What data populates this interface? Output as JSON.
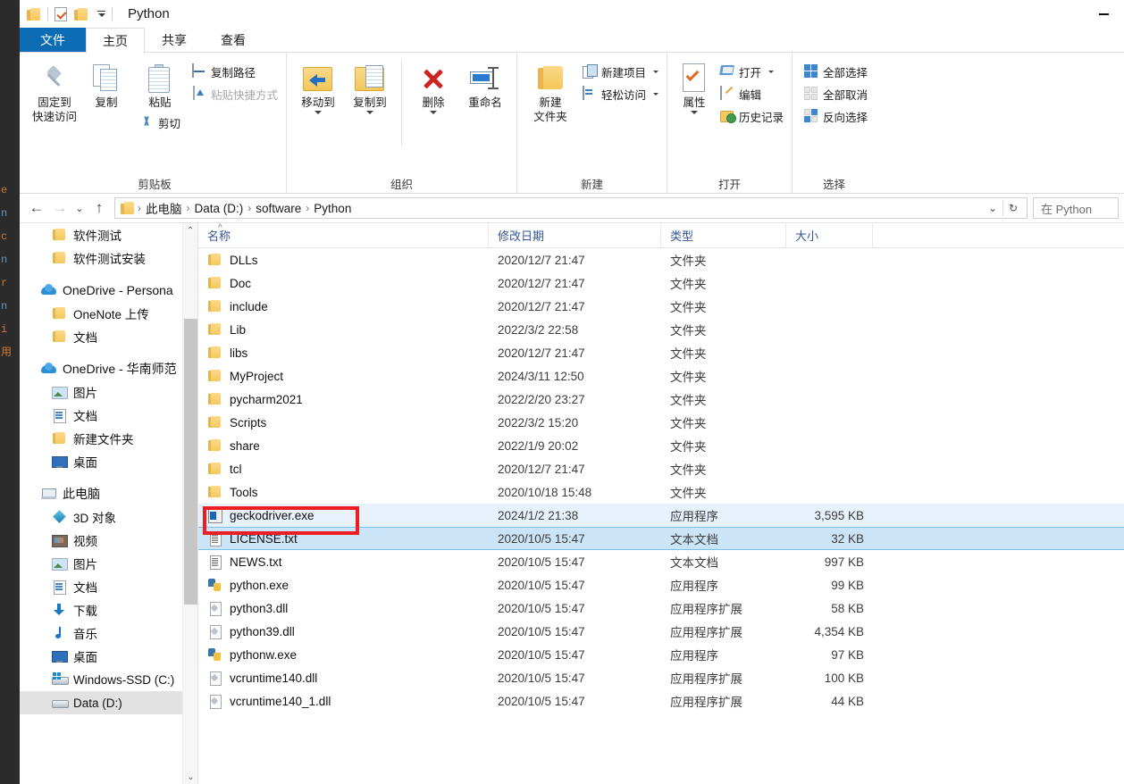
{
  "window": {
    "title": "Python",
    "minimize_label": "—",
    "quick_access": [
      "folder-icon",
      "properties-check-icon",
      "new-folder-icon",
      "customize-caret-icon"
    ]
  },
  "ribbon": {
    "tabs": [
      {
        "label": "文件",
        "state": "file"
      },
      {
        "label": "主页",
        "state": "active"
      },
      {
        "label": "共享",
        "state": "normal"
      },
      {
        "label": "查看",
        "state": "normal"
      }
    ],
    "groups": [
      {
        "name": "clipboard",
        "label": "剪贴板",
        "big_buttons": [
          {
            "label": "固定到\n快速访问",
            "line1": "固定到",
            "line2": "快速访问",
            "icon": "pin-icon"
          },
          {
            "label": "复制",
            "icon": "copy-icon"
          },
          {
            "label": "粘贴",
            "icon": "paste-icon"
          }
        ],
        "small_buttons": [
          {
            "label": "复制路径",
            "icon": "copy-path-icon"
          },
          {
            "label": "粘贴快捷方式",
            "icon": "paste-shortcut-icon",
            "dim": true
          },
          {
            "label": "剪切",
            "icon": "cut-scissors-icon"
          }
        ]
      },
      {
        "name": "organize",
        "label": "组织",
        "big_buttons": [
          {
            "label": "移动到",
            "icon": "move-to-icon",
            "has_caret": true
          },
          {
            "label": "复制到",
            "icon": "copy-to-icon",
            "has_caret": true
          },
          {
            "label": "删除",
            "icon": "delete-x-icon",
            "has_caret": true
          },
          {
            "label": "重命名",
            "icon": "rename-icon"
          }
        ]
      },
      {
        "name": "new",
        "label": "新建",
        "big_buttons": [
          {
            "line1": "新建",
            "line2": "文件夹",
            "label": "新建文件夹",
            "icon": "new-folder-icon"
          }
        ],
        "small_buttons": [
          {
            "label": "新建项目",
            "icon": "new-item-icon",
            "has_caret": true
          },
          {
            "label": "轻松访问",
            "icon": "easy-access-icon",
            "has_caret": true
          }
        ]
      },
      {
        "name": "open",
        "label": "打开",
        "big_buttons": [
          {
            "label": "属性",
            "icon": "properties-icon",
            "has_caret": true
          }
        ],
        "small_buttons": [
          {
            "label": "打开",
            "icon": "open-icon",
            "has_caret": true
          },
          {
            "label": "编辑",
            "icon": "edit-icon"
          },
          {
            "label": "历史记录",
            "icon": "history-icon"
          }
        ]
      },
      {
        "name": "select",
        "label": "选择",
        "small_buttons": [
          {
            "label": "全部选择",
            "icon": "select-all-icon"
          },
          {
            "label": "全部取消",
            "icon": "select-none-icon"
          },
          {
            "label": "反向选择",
            "icon": "invert-selection-icon"
          }
        ]
      }
    ]
  },
  "address": {
    "back_icon": "back-arrow-icon",
    "forward_icon": "forward-arrow-icon",
    "recent_icon": "recent-locations-caret-icon",
    "up_icon": "up-arrow-icon",
    "crumbs": [
      "此电脑",
      "Data (D:)",
      "software",
      "Python"
    ],
    "separator": "›",
    "dropdown_icon": "address-dropdown-icon",
    "refresh_icon": "refresh-icon",
    "search_text": "在 Python"
  },
  "nav_pane": {
    "items": [
      {
        "label": "软件测试",
        "icon": "folder-icon",
        "level": "child"
      },
      {
        "label": "软件测试安装",
        "icon": "folder-icon",
        "level": "child"
      },
      {
        "label": "",
        "icon": "",
        "level": "gap"
      },
      {
        "label": "OneDrive - Persona",
        "icon": "onedrive-cloud-icon",
        "level": "root"
      },
      {
        "label": "OneNote 上传",
        "icon": "folder-icon",
        "level": "child"
      },
      {
        "label": "文档",
        "icon": "folder-icon",
        "level": "child"
      },
      {
        "label": "",
        "icon": "",
        "level": "gap"
      },
      {
        "label": "OneDrive - 华南师范",
        "icon": "onedrive-cloud-icon",
        "level": "root"
      },
      {
        "label": "图片",
        "icon": "pictures-icon",
        "level": "child"
      },
      {
        "label": "文档",
        "icon": "documents-icon",
        "level": "child"
      },
      {
        "label": "新建文件夹",
        "icon": "folder-icon",
        "level": "child"
      },
      {
        "label": "桌面",
        "icon": "desktop-icon",
        "level": "child"
      },
      {
        "label": "",
        "icon": "",
        "level": "gap"
      },
      {
        "label": "此电脑",
        "icon": "this-pc-icon",
        "level": "root"
      },
      {
        "label": "3D 对象",
        "icon": "3d-objects-icon",
        "level": "child"
      },
      {
        "label": "视频",
        "icon": "videos-icon",
        "level": "child"
      },
      {
        "label": "图片",
        "icon": "pictures-icon",
        "level": "child"
      },
      {
        "label": "文档",
        "icon": "documents-icon",
        "level": "child"
      },
      {
        "label": "下载",
        "icon": "downloads-icon",
        "level": "child"
      },
      {
        "label": "音乐",
        "icon": "music-icon",
        "level": "child"
      },
      {
        "label": "桌面",
        "icon": "desktop-icon",
        "level": "child"
      },
      {
        "label": "Windows-SSD (C:)",
        "icon": "windows-drive-icon",
        "level": "child"
      },
      {
        "label": "Data (D:)",
        "icon": "drive-icon",
        "level": "child",
        "selected": true
      }
    ],
    "scroll_up_icon": "scroll-up-icon",
    "scroll_down_icon": "scroll-down-icon"
  },
  "file_list": {
    "columns": [
      "名称",
      "修改日期",
      "类型",
      "大小"
    ],
    "sort_column": "名称",
    "sort_indicator": "^",
    "rows": [
      {
        "name": "DLLs",
        "date": "2020/12/7 21:47",
        "type": "文件夹",
        "size": "",
        "icon": "folder-icon"
      },
      {
        "name": "Doc",
        "date": "2020/12/7 21:47",
        "type": "文件夹",
        "size": "",
        "icon": "folder-icon"
      },
      {
        "name": "include",
        "date": "2020/12/7 21:47",
        "type": "文件夹",
        "size": "",
        "icon": "folder-icon"
      },
      {
        "name": "Lib",
        "date": "2022/3/2 22:58",
        "type": "文件夹",
        "size": "",
        "icon": "folder-icon"
      },
      {
        "name": "libs",
        "date": "2020/12/7 21:47",
        "type": "文件夹",
        "size": "",
        "icon": "folder-icon"
      },
      {
        "name": "MyProject",
        "date": "2024/3/11 12:50",
        "type": "文件夹",
        "size": "",
        "icon": "folder-icon"
      },
      {
        "name": "pycharm2021",
        "date": "2022/2/20 23:27",
        "type": "文件夹",
        "size": "",
        "icon": "folder-icon"
      },
      {
        "name": "Scripts",
        "date": "2022/3/2 15:20",
        "type": "文件夹",
        "size": "",
        "icon": "folder-icon"
      },
      {
        "name": "share",
        "date": "2022/1/9 20:02",
        "type": "文件夹",
        "size": "",
        "icon": "folder-icon"
      },
      {
        "name": "tcl",
        "date": "2020/12/7 21:47",
        "type": "文件夹",
        "size": "",
        "icon": "folder-icon"
      },
      {
        "name": "Tools",
        "date": "2020/10/18 15:48",
        "type": "文件夹",
        "size": "",
        "icon": "folder-icon"
      },
      {
        "name": "geckodriver.exe",
        "date": "2024/1/2 21:38",
        "type": "应用程序",
        "size": "3,595 KB",
        "icon": "exe-icon",
        "selection": "soft",
        "annotated": true
      },
      {
        "name": "LICENSE.txt",
        "date": "2020/10/5 15:47",
        "type": "文本文档",
        "size": "32 KB",
        "icon": "text-file-icon",
        "selection": "hard"
      },
      {
        "name": "NEWS.txt",
        "date": "2020/10/5 15:47",
        "type": "文本文档",
        "size": "997 KB",
        "icon": "text-file-icon"
      },
      {
        "name": "python.exe",
        "date": "2020/10/5 15:47",
        "type": "应用程序",
        "size": "99 KB",
        "icon": "python-exe-icon"
      },
      {
        "name": "python3.dll",
        "date": "2020/10/5 15:47",
        "type": "应用程序扩展",
        "size": "58 KB",
        "icon": "dll-icon"
      },
      {
        "name": "python39.dll",
        "date": "2020/10/5 15:47",
        "type": "应用程序扩展",
        "size": "4,354 KB",
        "icon": "dll-icon"
      },
      {
        "name": "pythonw.exe",
        "date": "2020/10/5 15:47",
        "type": "应用程序",
        "size": "97 KB",
        "icon": "python-exe-icon"
      },
      {
        "name": "vcruntime140.dll",
        "date": "2020/10/5 15:47",
        "type": "应用程序扩展",
        "size": "100 KB",
        "icon": "dll-icon"
      },
      {
        "name": "vcruntime140_1.dll",
        "date": "2020/10/5 15:47",
        "type": "应用程序扩展",
        "size": "44 KB",
        "icon": "dll-icon"
      }
    ]
  },
  "annotation": {
    "color": "#ee1c23",
    "target": "geckodriver.exe"
  },
  "background_editor": {
    "lines": [
      "e",
      "n",
      "c",
      "n",
      "r",
      "n",
      "i",
      "用"
    ]
  },
  "colors": {
    "file_tab": "#0b6cb3",
    "selection_soft": "#e8f2fc",
    "selection_hard": "#cce4f7",
    "header_text": "#33569b",
    "annotation": "#ee1c23"
  }
}
